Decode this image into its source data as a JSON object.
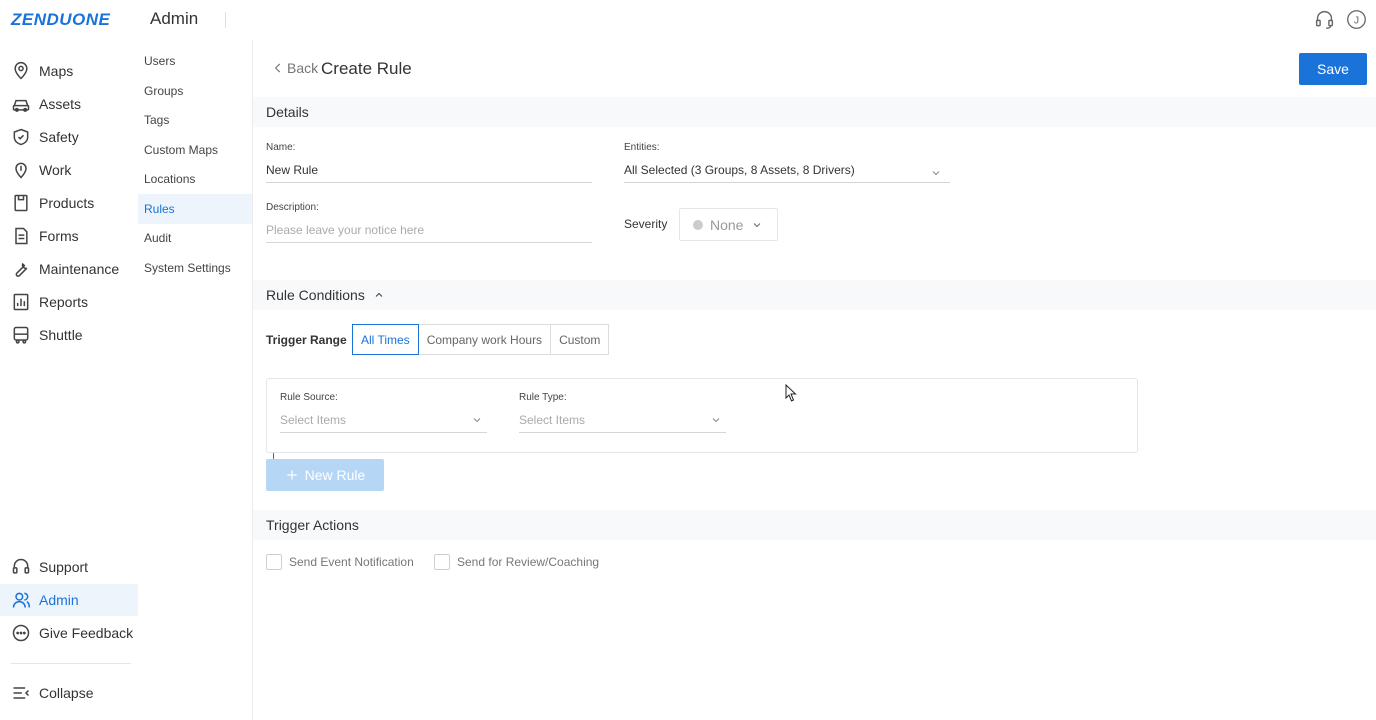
{
  "topbar": {
    "logo": "ZENDUONE",
    "section_title": "Admin",
    "icons": [
      "support-headset-icon",
      "user-avatar-icon"
    ],
    "avatar_initial": "J"
  },
  "sidebar": {
    "items": [
      {
        "label": "Maps",
        "icon": "map-pin-icon"
      },
      {
        "label": "Assets",
        "icon": "car-icon"
      },
      {
        "label": "Safety",
        "icon": "shield-icon"
      },
      {
        "label": "Work",
        "icon": "location-icon"
      },
      {
        "label": "Products",
        "icon": "box-icon"
      },
      {
        "label": "Forms",
        "icon": "document-icon"
      },
      {
        "label": "Maintenance",
        "icon": "wrench-icon"
      },
      {
        "label": "Reports",
        "icon": "chart-icon"
      },
      {
        "label": "Shuttle",
        "icon": "bus-icon"
      }
    ],
    "bottom_items": [
      {
        "label": "Support",
        "icon": "headset-icon"
      },
      {
        "label": "Admin",
        "icon": "users-icon",
        "active": true
      },
      {
        "label": "Give Feedback",
        "icon": "chat-icon"
      }
    ],
    "collapse_label": "Collapse"
  },
  "subnav": {
    "items": [
      "Users",
      "Groups",
      "Tags",
      "Custom Maps",
      "Locations",
      "Rules",
      "Audit",
      "System Settings"
    ],
    "active": "Rules"
  },
  "page": {
    "back_label": "Back",
    "title": "Create Rule",
    "save_label": "Save"
  },
  "details": {
    "section_label": "Details",
    "name_label": "Name:",
    "name_value": "New Rule",
    "description_label": "Description:",
    "description_placeholder": "Please leave your notice here",
    "entities_label": "Entities:",
    "entities_value": "All Selected (3 Groups, 8 Assets, 8 Drivers)",
    "severity_label": "Severity",
    "severity_value": "None"
  },
  "conditions": {
    "section_label": "Rule Conditions",
    "trigger_range_label": "Trigger Range",
    "trigger_options": [
      "All Times",
      "Company work Hours",
      "Custom"
    ],
    "trigger_selected": "All Times",
    "rule_source_label": "Rule Source:",
    "rule_source_placeholder": "Select Items",
    "rule_type_label": "Rule Type:",
    "rule_type_placeholder": "Select Items",
    "new_rule_label": "New Rule"
  },
  "actions": {
    "section_label": "Trigger Actions",
    "options": [
      "Send Event Notification",
      "Send for Review/Coaching"
    ]
  },
  "colors": {
    "accent": "#1a73d9",
    "band": "#f7f9fb",
    "disabled_button": "#b6d6f5"
  }
}
